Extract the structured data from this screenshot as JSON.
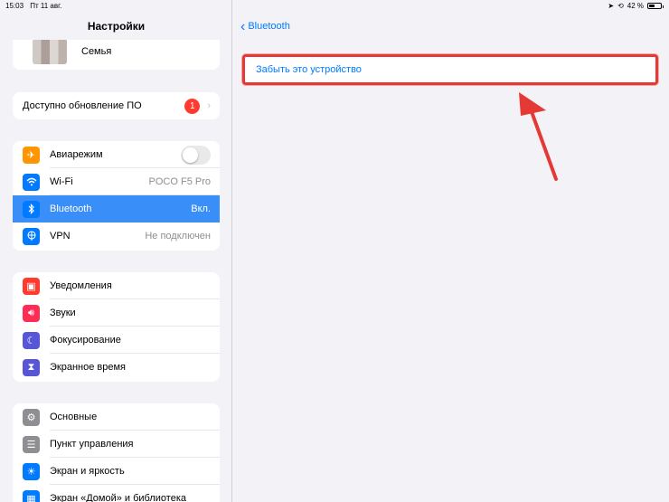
{
  "status_bar": {
    "time": "15:03",
    "date": "Пт 11 авг.",
    "battery": "42 %",
    "battery_level": 0.42
  },
  "sidebar": {
    "title": "Настройки",
    "account": {
      "label": "Семья"
    },
    "update": {
      "label": "Доступно обновление ПО",
      "badge": "1"
    },
    "connectivity": [
      {
        "label": "Авиарежим",
        "icon": "airplane-icon",
        "color": "#ff9500",
        "toggle": false
      },
      {
        "label": "Wi-Fi",
        "value": "POCO F5 Pro",
        "icon": "wifi-icon",
        "color": "#007aff"
      },
      {
        "label": "Bluetooth",
        "value": "Вкл.",
        "icon": "bluetooth-icon",
        "color": "#007aff",
        "selected": true
      },
      {
        "label": "VPN",
        "value": "Не подключен",
        "icon": "vpn-icon",
        "color": "#007aff"
      }
    ],
    "notifications": [
      {
        "label": "Уведомления",
        "icon": "notifications-icon",
        "color": "#ff3b30"
      },
      {
        "label": "Звуки",
        "icon": "sounds-icon",
        "color": "#ff2d55"
      },
      {
        "label": "Фокусирование",
        "icon": "focus-icon",
        "color": "#5856d6"
      },
      {
        "label": "Экранное время",
        "icon": "screen-time-icon",
        "color": "#5856d6"
      }
    ],
    "general": [
      {
        "label": "Основные",
        "icon": "gear-icon",
        "color": "#8e8e93"
      },
      {
        "label": "Пункт управления",
        "icon": "control-center-icon",
        "color": "#8e8e93"
      },
      {
        "label": "Экран и яркость",
        "icon": "brightness-icon",
        "color": "#007aff"
      },
      {
        "label": "Экран «Домой» и библиотека",
        "icon": "home-screen-icon",
        "color": "#007aff"
      }
    ]
  },
  "detail": {
    "back_label": "Bluetooth",
    "forget_label": "Забыть это устройство",
    "highlight_color": "#e53935"
  }
}
